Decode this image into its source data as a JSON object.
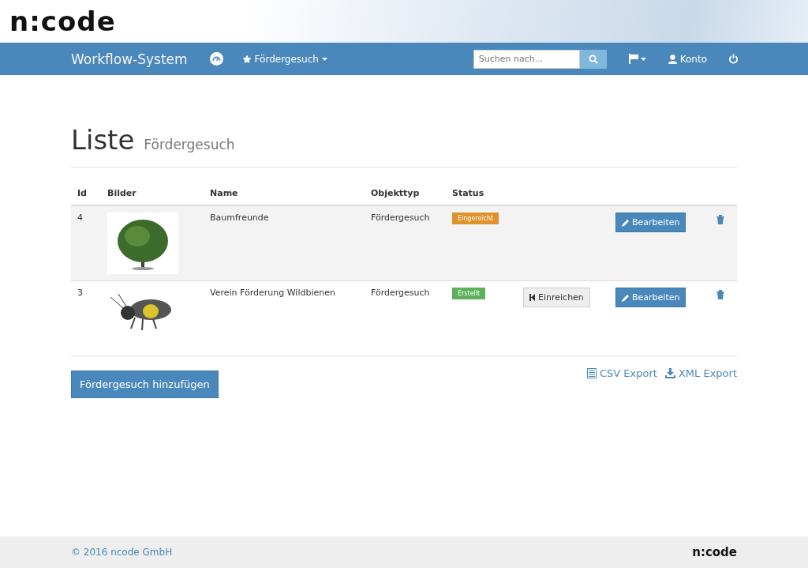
{
  "header": {
    "logo": "n:code"
  },
  "navbar": {
    "brand": "Workflow-System",
    "menu": {
      "label": "Fördergesuch"
    },
    "search": {
      "placeholder": "Suchen nach..."
    },
    "account": "Konto"
  },
  "page": {
    "title": "Liste",
    "subtitle": "Fördergesuch"
  },
  "table": {
    "columns": [
      "Id",
      "Bilder",
      "Name",
      "Objekttyp",
      "Status"
    ],
    "rows": [
      {
        "id": "4",
        "name": "Baumfreunde",
        "type": "Fördergesuch",
        "status": {
          "label": "Eingereicht",
          "color": "#e0922a"
        },
        "submit": null,
        "edit": "Bearbeiten",
        "striped": true
      },
      {
        "id": "3",
        "name": "Verein Förderung Wildbienen",
        "type": "Fördergesuch",
        "status": {
          "label": "Erstellt",
          "color": "#5cb05c"
        },
        "submit": "Einreichen",
        "edit": "Bearbeiten",
        "striped": false
      }
    ]
  },
  "add_button": "Fördergesuch hinzufügen",
  "exports": [
    {
      "kind": "list",
      "label": "CSV Export"
    },
    {
      "kind": "download",
      "label": "XML Export"
    }
  ],
  "footer": {
    "copyright": "© 2016 ncode GmbH",
    "logo": "n:code"
  }
}
